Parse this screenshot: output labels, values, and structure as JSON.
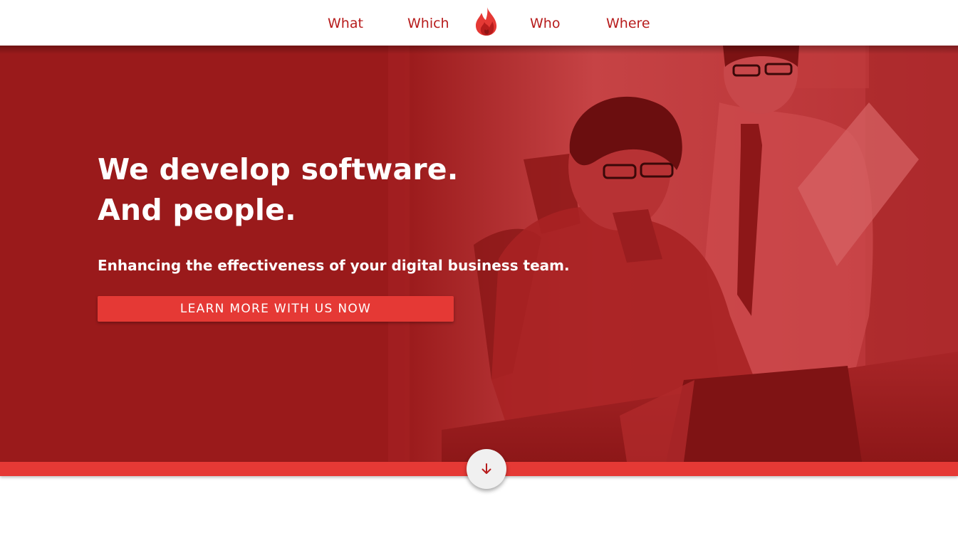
{
  "nav": {
    "items": [
      {
        "label": "What"
      },
      {
        "label": "Which"
      },
      {
        "label": "Who"
      },
      {
        "label": "Where"
      }
    ],
    "logo_icon": "flame-icon"
  },
  "hero": {
    "title_line1": "We develop software.",
    "title_line2": "And people.",
    "subtitle": "Enhancing the effectiveness of your digital business team.",
    "cta_label": "LEARN MORE WITH US NOW",
    "background_image": "two-men-at-laptop-photo"
  },
  "scroll_down_icon": "arrow-down-icon",
  "colors": {
    "brand_red": "#b71c1c",
    "hero_overlay": "#9a1a1b",
    "accent": "#e53935",
    "white": "#ffffff"
  }
}
